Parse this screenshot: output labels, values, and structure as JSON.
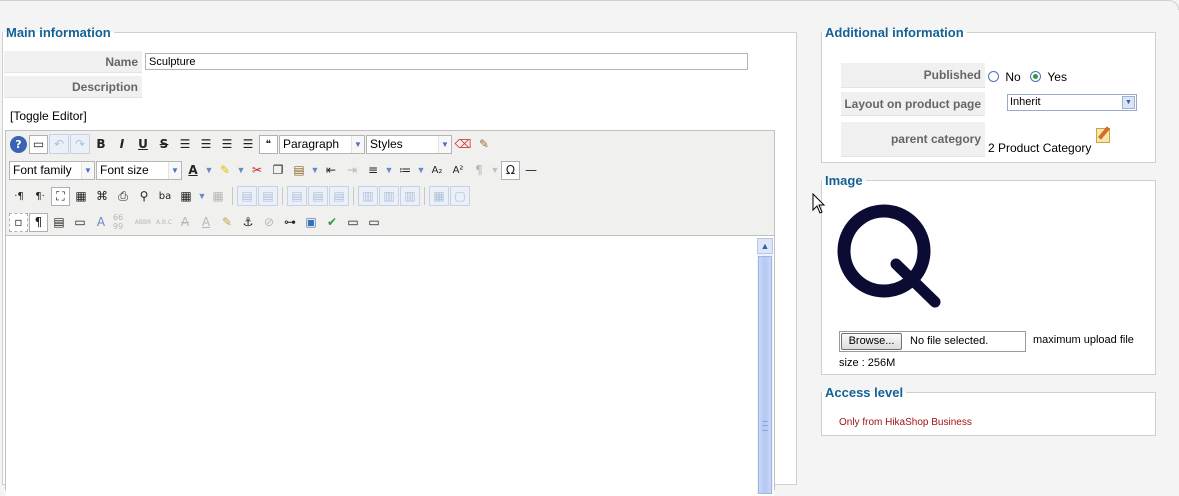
{
  "main": {
    "legend": "Main information",
    "name_label": "Name",
    "name_value": "Sculpture",
    "description_label": "Description",
    "toggle_editor": "[Toggle Editor]"
  },
  "toolbar": {
    "paragraph": "Paragraph",
    "styles": "Styles",
    "font_family": "Font family",
    "font_size": "Font size",
    "bold": "B",
    "italic": "I",
    "underline": "U",
    "strike": "S",
    "help": "?"
  },
  "additional": {
    "legend": "Additional information",
    "published_label": "Published",
    "published_no": "No",
    "published_yes": "Yes",
    "published_value": "Yes",
    "layout_label": "Layout on product page",
    "layout_value": "Inherit",
    "parent_label": "parent category",
    "parent_value": "2 Product Category"
  },
  "image": {
    "legend": "Image",
    "preview_letter": "Q",
    "browse_label": "Browse...",
    "no_file": "No file selected.",
    "upload_note_a": "maximum upload file",
    "upload_note_b": "size : 256M"
  },
  "access": {
    "legend": "Access level",
    "value": "Only from HikaShop Business"
  },
  "colors": {
    "legend_blue": "#146295",
    "access_red": "#a01515",
    "image_q": "#0b0b33"
  }
}
